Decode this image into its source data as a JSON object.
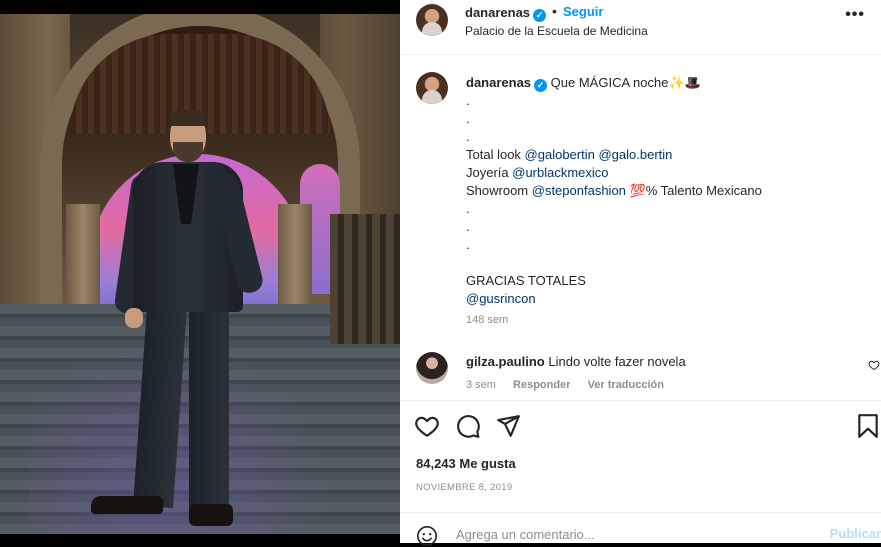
{
  "post": {
    "author": "danarenas",
    "follow_label": "Seguir",
    "separator": "•",
    "location": "Palacio de la Escuela de Medicina",
    "more_label": "•••"
  },
  "caption": {
    "author": "danarenas",
    "first_line": "Que MÁGICA noche✨🎩",
    "dots1": [
      ".",
      ".",
      "."
    ],
    "total_look_prefix": "Total look ",
    "total_look_mention1": "@galobertin",
    "total_look_mention2": "@galo.bertin",
    "joyeria_prefix": "Joyería ",
    "joyeria_mention": "@urblackmexico",
    "showroom_prefix": "Showroom ",
    "showroom_mention": "@steponfashion",
    "showroom_suffix": " 💯% Talento Mexicano",
    "dots2": [
      ".",
      ".",
      "."
    ],
    "thanks": "GRACIAS TOTALES",
    "thanks_mention": "@gusrincon",
    "time": "148 sem"
  },
  "comment": {
    "author": "gilza.paulino",
    "text": "Lindo volte fazer novela",
    "time": "3 sem",
    "reply_label": "Responder",
    "translate_label": "Ver traducción"
  },
  "actions": {
    "likes": "84,243 Me gusta",
    "date": "NOVIEMBRE 8, 2019"
  },
  "add_comment": {
    "placeholder": "Agrega un comentario...",
    "post_label": "Publicar"
  },
  "colors": {
    "accent": "#0095f6",
    "mention": "#00376b",
    "muted": "#8e8e8e",
    "post_disabled": "#b2dffc"
  },
  "icons": [
    "verified-icon",
    "more-icon",
    "heart-icon",
    "comment-icon",
    "share-icon",
    "save-icon",
    "emoji-icon"
  ]
}
